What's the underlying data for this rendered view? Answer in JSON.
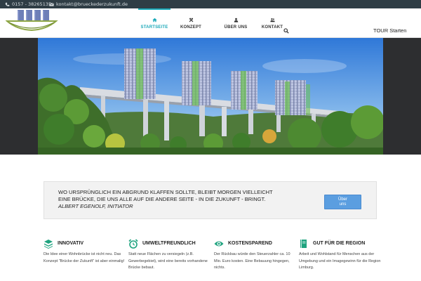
{
  "topbar": {
    "phone": "0157 - 38265135",
    "email": "kontakt@brueckederzukunft.de"
  },
  "nav": {
    "items": [
      {
        "label": "STARTSEITE",
        "icon": "home-icon",
        "active": true
      },
      {
        "label": "KONZEPT",
        "icon": "tools-icon",
        "active": false
      },
      {
        "label": "ÜBER UNS",
        "icon": "user-icon",
        "active": false
      },
      {
        "label": "KONTAKT",
        "icon": "people-icon",
        "active": false
      }
    ],
    "tour_label": "TOUR Starten"
  },
  "quote": {
    "text": "Wo ursprünglich ein Abgrund klaffen sollte, bleibt morgen vielleicht eine Brücke, die uns alle auf die andere Seite - in die Zukunft - bringt.",
    "author": "Albert Egenolf, Initiator",
    "button_line1": "Über",
    "button_line2": "uns"
  },
  "features": [
    {
      "icon": "layers-icon",
      "title": "INNOVATIV",
      "text": "Die Idee einer Wohnbrücke ist nicht neu. Das Konzept \"Brücke der Zukunft\" ist aber einmalig!"
    },
    {
      "icon": "alarm-clock-icon",
      "title": "UMWELTFREUNDLICH",
      "text": "Statt neue Flächen zu versiegeln (z.B. Gewerbegebiet), wird eine bereits vorhandene Brücke bebaut."
    },
    {
      "icon": "eye-icon",
      "title": "KOSTENSPAREND",
      "text": "Der Rückbau würde den Steuerzahler ca. 10 Mio. Euro kosten. Eine Bebauung hingegen, nichts."
    },
    {
      "icon": "book-icon",
      "title": "GUT FÜR DIE REGION",
      "text": "Arbeit und Wohlstand für Menschen aus der Umgebung und ein Imagegewinn für die Region Limburg."
    }
  ],
  "colors": {
    "accent": "#1aa8b8",
    "topbar": "#2f3d45",
    "hero_band": "#2d2e30",
    "button": "#5b9ee0"
  }
}
